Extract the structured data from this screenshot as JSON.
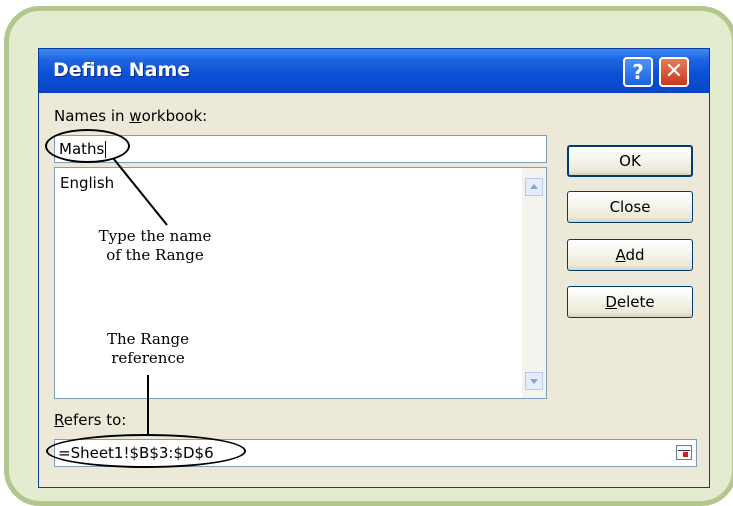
{
  "dialog": {
    "title": "Define Name",
    "help_button": "?",
    "close_button": "✕",
    "names_label_pre": "Names in ",
    "names_label_u": "w",
    "names_label_post": "orkbook:",
    "name_value": "Maths",
    "list_items": [
      "English"
    ],
    "refers_label_u": "R",
    "refers_label_post": "efers to:",
    "refers_value": "=Sheet1!$B$3:$D$6"
  },
  "buttons": {
    "ok": "OK",
    "close": "Close",
    "add_u": "A",
    "add_rest": "dd",
    "delete_u": "D",
    "delete_rest": "elete"
  },
  "annotations": {
    "name_line1": "Type the name",
    "name_line2": "of the Range",
    "ref_line1": "The Range",
    "ref_line2": "reference"
  },
  "icons": {
    "range_collapse": "range-collapse-icon",
    "scroll_up": "scroll-up-icon",
    "scroll_down": "scroll-down-icon"
  }
}
